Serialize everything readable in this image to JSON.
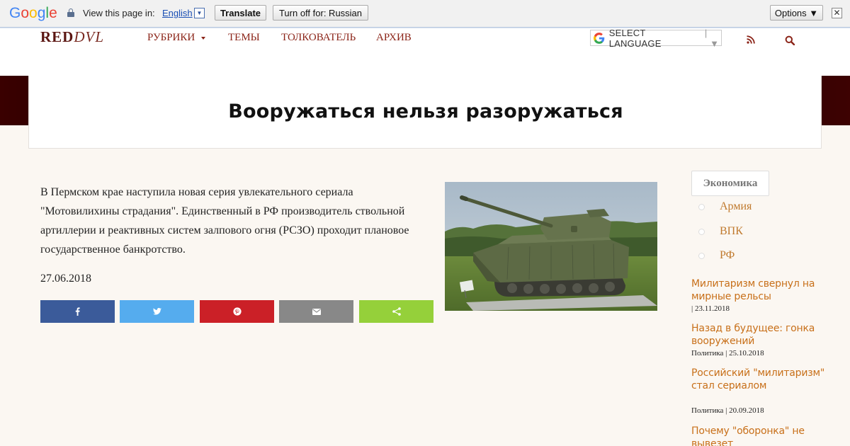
{
  "translate_bar": {
    "logo_letters": [
      "G",
      "o",
      "o",
      "g",
      "l",
      "e"
    ],
    "logo_colors": [
      "#4285f4",
      "#ea4335",
      "#fbbc05",
      "#4285f4",
      "#34a853",
      "#ea4335"
    ],
    "view_text": "View this page in:",
    "language": "English",
    "translate_label": "Translate",
    "turn_off_label": "Turn off for: Russian",
    "options_label": "Options ▼",
    "close_glyph": "✕"
  },
  "header": {
    "logo_main": "RED",
    "logo_tail": "DVL",
    "nav": [
      "РУБРИКИ",
      "ТЕМЫ",
      "ТОЛКОВАТЕЛЬ",
      "АРХИВ"
    ],
    "language_select": "SELECT LANGUAGE",
    "language_select_arrow": "▼"
  },
  "article": {
    "title": "Вооружаться нельзя разоружаться",
    "lead": "В Пермском крае наступила новая серия увлекательного сериала \"Мотовилихины страдания\". Единственный в РФ производитель ствольной артиллерии и реактивных систем залпового огня (РСЗО) проходит плановое государственное банкротство.",
    "date": "27.06.2018",
    "share_icons": [
      "facebook-icon",
      "twitter-icon",
      "pinterest-icon",
      "email-icon",
      "share-icon"
    ]
  },
  "sidebar": {
    "tag": "Экономика",
    "categories": [
      "Армия",
      "ВПК",
      "РФ"
    ],
    "posts": [
      {
        "title": "Милитаризм свернул на мирные рельсы",
        "meta": "| 23.11.2018"
      },
      {
        "title": "Назад в будущее: гонка вооружений",
        "meta": "Политика | 25.10.2018"
      },
      {
        "title": "Российский \"милитаризм\" стал сериалом",
        "meta": "Политика | 20.09.2018"
      },
      {
        "title": "Почему \"оборонка\" не вывезет",
        "meta": ""
      }
    ]
  },
  "colors": {
    "accent": "#8b2418",
    "link_orange": "#c8701a",
    "facebook": "#3b5b9a",
    "twitter": "#55acee",
    "pinterest": "#cb2027",
    "email": "#888888",
    "share": "#95d03a"
  }
}
